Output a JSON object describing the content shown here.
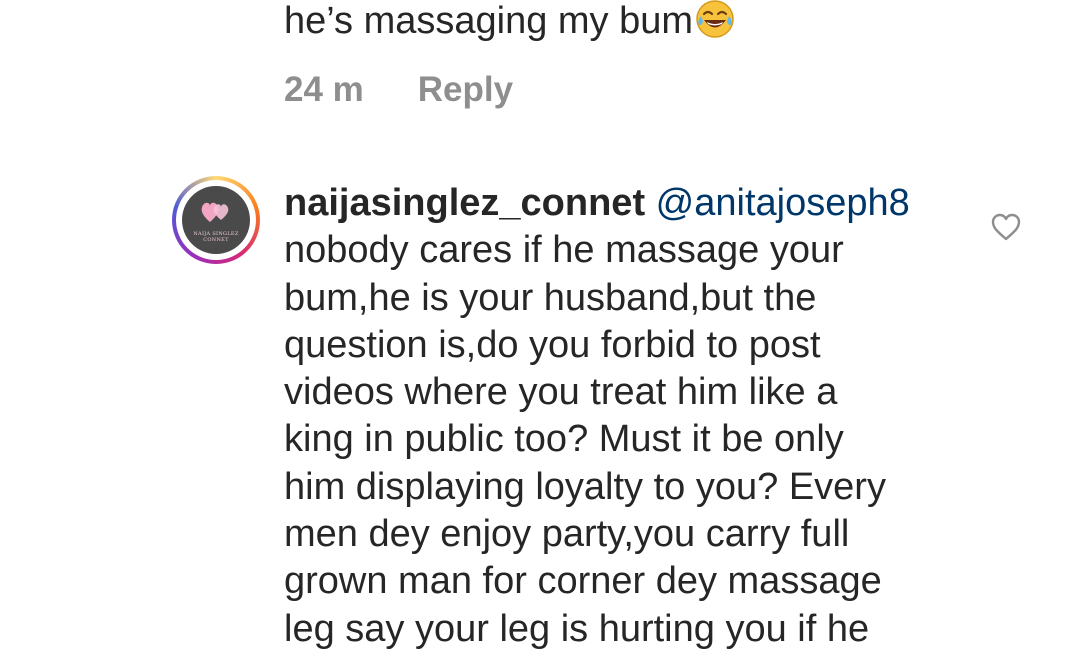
{
  "previous_comment": {
    "lines_visible": [
      "he’s massaging my bum"
    ],
    "emoji": "😂",
    "time": "24 m",
    "reply_label": "Reply"
  },
  "comment": {
    "username": "naijasinglez_connet",
    "mention": "@anitajoseph8",
    "avatar_caption": "NAIJA SINGLEZ CONNET",
    "lines": [
      "nobody cares if he massage your",
      "bum,he is your husband,but the",
      "question is,do you forbid to post",
      "videos where you treat him like a",
      "king in public too? Must it be only",
      "him displaying loyalty to you? Every",
      "men dey enjoy party,you carry full",
      "grown man for corner dey massage",
      "leg say your leg is hurting you if he"
    ]
  },
  "icons": {
    "like": "heart-outline-icon",
    "emoji": "tears-of-joy-emoji-icon"
  },
  "colors": {
    "text": "#262626",
    "meta": "#8e8e8e",
    "mention": "#00376b",
    "avatar_bg": "#4a4a4a"
  }
}
